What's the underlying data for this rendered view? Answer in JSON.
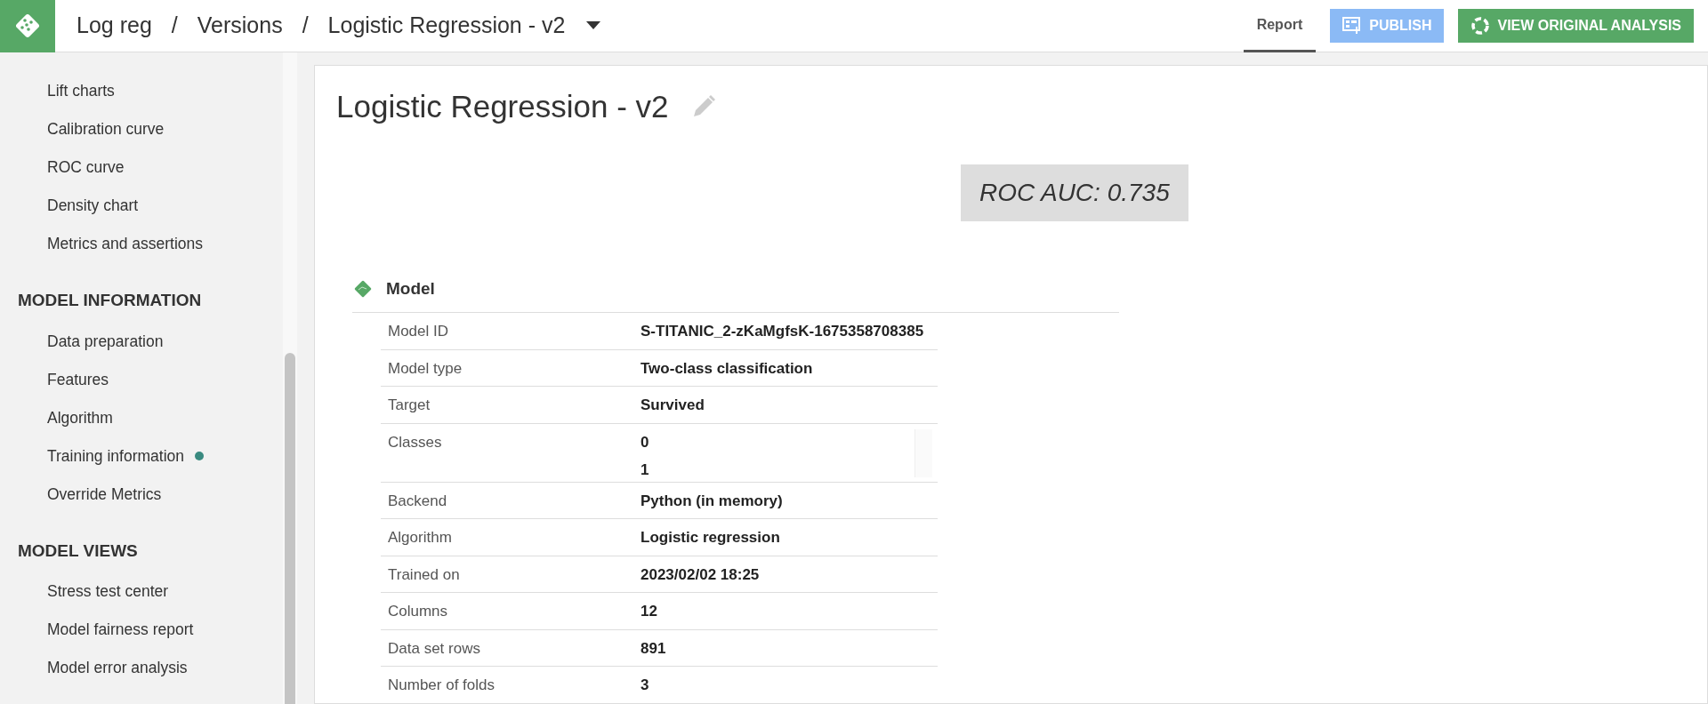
{
  "header": {
    "breadcrumb": [
      "Log reg",
      "Versions",
      "Logistic Regression - v2"
    ],
    "separator": "/",
    "tabs": [
      {
        "label": "Report",
        "selected": true
      }
    ],
    "buttons": [
      {
        "kind": "publish",
        "label": "PUBLISH",
        "disabled": true
      },
      {
        "kind": "original",
        "label": "VIEW ORIGINAL ANALYSIS",
        "disabled": false
      }
    ]
  },
  "sidebar": {
    "sections": [
      {
        "items": [
          {
            "label": "Lift charts",
            "dot": false
          },
          {
            "label": "Calibration curve",
            "dot": false
          },
          {
            "label": "ROC curve",
            "dot": false
          },
          {
            "label": "Density chart",
            "dot": false
          },
          {
            "label": "Metrics and assertions",
            "dot": false
          }
        ]
      },
      {
        "title": "MODEL INFORMATION",
        "items": [
          {
            "label": "Data preparation",
            "dot": false
          },
          {
            "label": "Features",
            "dot": false
          },
          {
            "label": "Algorithm",
            "dot": false
          },
          {
            "label": "Training information",
            "dot": true
          },
          {
            "label": "Override Metrics",
            "dot": false
          }
        ]
      },
      {
        "title": "MODEL VIEWS",
        "items": [
          {
            "label": "Stress test center",
            "dot": false
          },
          {
            "label": "Model fairness report",
            "dot": false
          },
          {
            "label": "Model error analysis",
            "dot": false
          }
        ]
      }
    ]
  },
  "report": {
    "title": "Logistic Regression - v2",
    "metric": "ROC AUC: 0.735",
    "section_title": "Model",
    "rows": [
      {
        "label": "Model ID",
        "values": [
          "S-TITANIC_2-zKaMgfsK-1675358708385"
        ]
      },
      {
        "label": "Model type",
        "values": [
          "Two-class classification"
        ]
      },
      {
        "label": "Target",
        "values": [
          "Survived"
        ]
      },
      {
        "label": "Classes",
        "values": [
          "0",
          "1"
        ]
      },
      {
        "label": "Backend",
        "values": [
          "Python (in memory)"
        ]
      },
      {
        "label": "Algorithm",
        "values": [
          "Logistic regression"
        ]
      },
      {
        "label": "Trained on",
        "values": [
          "2023/02/02 18:25"
        ]
      },
      {
        "label": "Columns",
        "values": [
          "12"
        ]
      },
      {
        "label": "Data set rows",
        "values": [
          "891"
        ]
      },
      {
        "label": "Number of folds",
        "values": [
          "3"
        ]
      }
    ]
  }
}
